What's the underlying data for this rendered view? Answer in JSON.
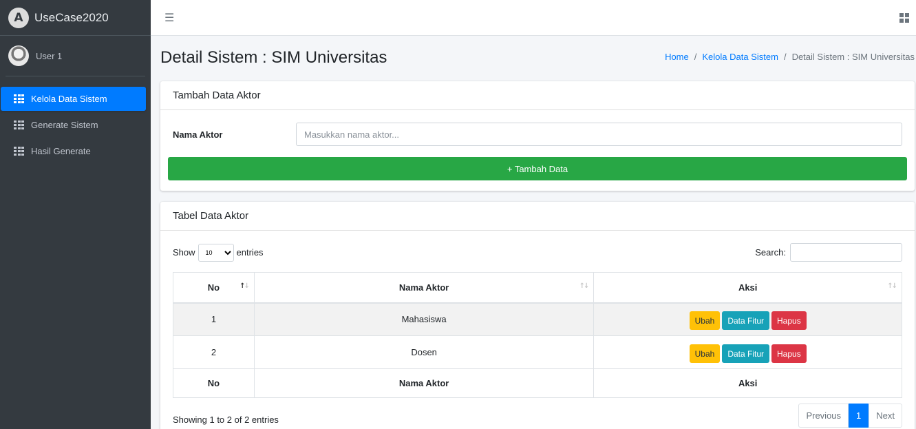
{
  "brand": {
    "logo_letter": "A",
    "name": "UseCase2020"
  },
  "user": {
    "name": "User 1"
  },
  "sidebar": {
    "items": [
      {
        "label": "Kelola Data Sistem",
        "active": true,
        "icon": "grid-icon"
      },
      {
        "label": "Generate Sistem",
        "active": false,
        "icon": "grid-icon"
      },
      {
        "label": "Hasil Generate",
        "active": false,
        "icon": "grid-icon"
      }
    ]
  },
  "topbar": {
    "menu_icon": "☰",
    "apps_icon": "grid-2x2-icon"
  },
  "page": {
    "title": "Detail Sistem : SIM Universitas",
    "breadcrumb": [
      "Home",
      "Kelola Data Sistem",
      "Detail Sistem : SIM Universitas"
    ],
    "breadcrumb_sep": "/"
  },
  "form_card": {
    "title": "Tambah Data Aktor",
    "field_label": "Nama Aktor",
    "field_placeholder": "Masukkan nama aktor...",
    "field_value": "",
    "submit_label": "+ Tambah Data"
  },
  "table_card": {
    "title": "Tabel Data Aktor",
    "length_prefix": "Show",
    "length_value": "10",
    "length_suffix": "entries",
    "search_label": "Search:",
    "search_value": "",
    "columns": [
      "No",
      "Nama Aktor",
      "Aksi"
    ],
    "rows": [
      {
        "no": "1",
        "nama": "Mahasiswa"
      },
      {
        "no": "2",
        "nama": "Dosen"
      }
    ],
    "action_labels": {
      "edit": "Ubah",
      "features": "Data Fitur",
      "delete": "Hapus"
    },
    "info": "Showing 1 to 2 of 2 entries",
    "pagination": {
      "previous": "Previous",
      "current": "1",
      "next": "Next"
    }
  },
  "colors": {
    "sidebar_bg": "#343a40",
    "primary": "#007bff",
    "success": "#28a745",
    "warning": "#ffc107",
    "info": "#17a2b8",
    "danger": "#dc3545"
  }
}
